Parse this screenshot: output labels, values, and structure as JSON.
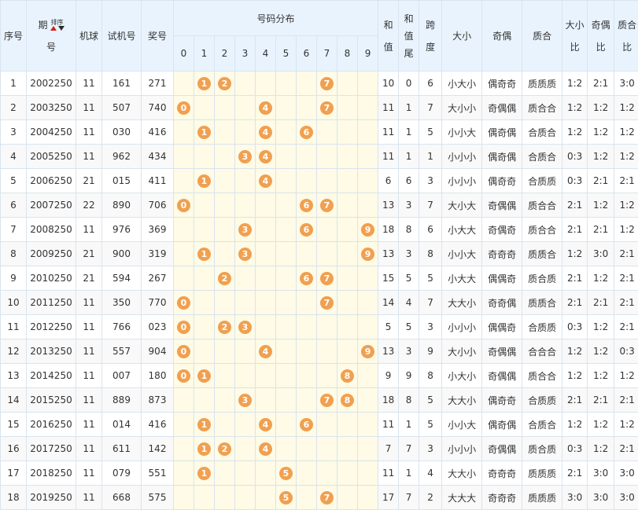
{
  "headers": {
    "seq": "序号",
    "period_top": "期",
    "period_bottom": "号",
    "sort_label": "排序",
    "machine": "机球",
    "test": "试机号",
    "prize": "奖号",
    "distribution": "号码分布",
    "digits": [
      "0",
      "1",
      "2",
      "3",
      "4",
      "5",
      "6",
      "7",
      "8",
      "9"
    ],
    "sum": [
      "和",
      "值"
    ],
    "sum_tail": [
      "和",
      "值",
      "尾"
    ],
    "span": [
      "跨",
      "度"
    ],
    "size": "大小",
    "parity": "奇偶",
    "prime": "质合",
    "size_ratio": [
      "大小",
      "比"
    ],
    "parity_ratio": [
      "奇偶",
      "比"
    ],
    "prime_ratio": [
      "质合",
      "比"
    ]
  },
  "rows": [
    {
      "seq": "1",
      "period": "2002250",
      "machine": "11",
      "test": "161",
      "prize": "271",
      "balls": [
        "1",
        "2",
        "7"
      ],
      "sum": "10",
      "tail": "0",
      "span": "6",
      "size": "小大小",
      "parity": "偶奇奇",
      "prime": "质质质",
      "sr": "1:2",
      "pr": "2:1",
      "qr": "3:0"
    },
    {
      "seq": "2",
      "period": "2003250",
      "machine": "11",
      "test": "507",
      "prize": "740",
      "balls": [
        "0",
        "4",
        "7"
      ],
      "sum": "11",
      "tail": "1",
      "span": "7",
      "size": "大小小",
      "parity": "奇偶偶",
      "prime": "质合合",
      "sr": "1:2",
      "pr": "1:2",
      "qr": "1:2"
    },
    {
      "seq": "3",
      "period": "2004250",
      "machine": "11",
      "test": "030",
      "prize": "416",
      "balls": [
        "1",
        "4",
        "6"
      ],
      "sum": "11",
      "tail": "1",
      "span": "5",
      "size": "小小大",
      "parity": "偶奇偶",
      "prime": "合质合",
      "sr": "1:2",
      "pr": "1:2",
      "qr": "1:2"
    },
    {
      "seq": "4",
      "period": "2005250",
      "machine": "11",
      "test": "962",
      "prize": "434",
      "balls": [
        "3",
        "4"
      ],
      "sum": "11",
      "tail": "1",
      "span": "1",
      "size": "小小小",
      "parity": "偶奇偶",
      "prime": "合质合",
      "sr": "0:3",
      "pr": "1:2",
      "qr": "1:2"
    },
    {
      "seq": "5",
      "period": "2006250",
      "machine": "21",
      "test": "015",
      "prize": "411",
      "balls": [
        "1",
        "4"
      ],
      "sum": "6",
      "tail": "6",
      "span": "3",
      "size": "小小小",
      "parity": "偶奇奇",
      "prime": "合质质",
      "sr": "0:3",
      "pr": "2:1",
      "qr": "2:1"
    },
    {
      "seq": "6",
      "period": "2007250",
      "machine": "22",
      "test": "890",
      "prize": "706",
      "balls": [
        "0",
        "6",
        "7"
      ],
      "sum": "13",
      "tail": "3",
      "span": "7",
      "size": "大小大",
      "parity": "奇偶偶",
      "prime": "质合合",
      "sr": "2:1",
      "pr": "1:2",
      "qr": "1:2"
    },
    {
      "seq": "7",
      "period": "2008250",
      "machine": "11",
      "test": "976",
      "prize": "369",
      "balls": [
        "3",
        "6",
        "9"
      ],
      "sum": "18",
      "tail": "8",
      "span": "6",
      "size": "小大大",
      "parity": "奇偶奇",
      "prime": "质合合",
      "sr": "2:1",
      "pr": "2:1",
      "qr": "1:2"
    },
    {
      "seq": "8",
      "period": "2009250",
      "machine": "21",
      "test": "900",
      "prize": "319",
      "balls": [
        "1",
        "3",
        "9"
      ],
      "sum": "13",
      "tail": "3",
      "span": "8",
      "size": "小小大",
      "parity": "奇奇奇",
      "prime": "质质合",
      "sr": "1:2",
      "pr": "3:0",
      "qr": "2:1"
    },
    {
      "seq": "9",
      "period": "2010250",
      "machine": "21",
      "test": "594",
      "prize": "267",
      "balls": [
        "2",
        "6",
        "7"
      ],
      "sum": "15",
      "tail": "5",
      "span": "5",
      "size": "小大大",
      "parity": "偶偶奇",
      "prime": "质合质",
      "sr": "2:1",
      "pr": "1:2",
      "qr": "2:1"
    },
    {
      "seq": "10",
      "period": "2011250",
      "machine": "11",
      "test": "350",
      "prize": "770",
      "balls": [
        "0",
        "7"
      ],
      "sum": "14",
      "tail": "4",
      "span": "7",
      "size": "大大小",
      "parity": "奇奇偶",
      "prime": "质质合",
      "sr": "2:1",
      "pr": "2:1",
      "qr": "2:1"
    },
    {
      "seq": "11",
      "period": "2012250",
      "machine": "11",
      "test": "766",
      "prize": "023",
      "balls": [
        "0",
        "2",
        "3"
      ],
      "sum": "5",
      "tail": "5",
      "span": "3",
      "size": "小小小",
      "parity": "偶偶奇",
      "prime": "合质质",
      "sr": "0:3",
      "pr": "1:2",
      "qr": "2:1"
    },
    {
      "seq": "12",
      "period": "2013250",
      "machine": "11",
      "test": "557",
      "prize": "904",
      "balls": [
        "0",
        "4",
        "9"
      ],
      "sum": "13",
      "tail": "3",
      "span": "9",
      "size": "大小小",
      "parity": "奇偶偶",
      "prime": "合合合",
      "sr": "1:2",
      "pr": "1:2",
      "qr": "0:3"
    },
    {
      "seq": "13",
      "period": "2014250",
      "machine": "11",
      "test": "007",
      "prize": "180",
      "balls": [
        "0",
        "1",
        "8"
      ],
      "sum": "9",
      "tail": "9",
      "span": "8",
      "size": "小大小",
      "parity": "奇偶偶",
      "prime": "质合合",
      "sr": "1:2",
      "pr": "1:2",
      "qr": "1:2"
    },
    {
      "seq": "14",
      "period": "2015250",
      "machine": "11",
      "test": "889",
      "prize": "873",
      "balls": [
        "3",
        "7",
        "8"
      ],
      "sum": "18",
      "tail": "8",
      "span": "5",
      "size": "大大小",
      "parity": "偶奇奇",
      "prime": "合质质",
      "sr": "2:1",
      "pr": "2:1",
      "qr": "2:1"
    },
    {
      "seq": "15",
      "period": "2016250",
      "machine": "11",
      "test": "014",
      "prize": "416",
      "balls": [
        "1",
        "4",
        "6"
      ],
      "sum": "11",
      "tail": "1",
      "span": "5",
      "size": "小小大",
      "parity": "偶奇偶",
      "prime": "合质合",
      "sr": "1:2",
      "pr": "1:2",
      "qr": "1:2"
    },
    {
      "seq": "16",
      "period": "2017250",
      "machine": "11",
      "test": "611",
      "prize": "142",
      "balls": [
        "1",
        "2",
        "4"
      ],
      "sum": "7",
      "tail": "7",
      "span": "3",
      "size": "小小小",
      "parity": "奇偶偶",
      "prime": "质合质",
      "sr": "0:3",
      "pr": "1:2",
      "qr": "2:1"
    },
    {
      "seq": "17",
      "period": "2018250",
      "machine": "11",
      "test": "079",
      "prize": "551",
      "balls": [
        "1",
        "5"
      ],
      "sum": "11",
      "tail": "1",
      "span": "4",
      "size": "大大小",
      "parity": "奇奇奇",
      "prime": "质质质",
      "sr": "2:1",
      "pr": "3:0",
      "qr": "3:0"
    },
    {
      "seq": "18",
      "period": "2019250",
      "machine": "11",
      "test": "668",
      "prize": "575",
      "balls": [
        "5",
        "7"
      ],
      "sum": "17",
      "tail": "7",
      "span": "2",
      "size": "大大大",
      "parity": "奇奇奇",
      "prime": "质质质",
      "sr": "3:0",
      "pr": "3:0",
      "qr": "3:0"
    }
  ]
}
